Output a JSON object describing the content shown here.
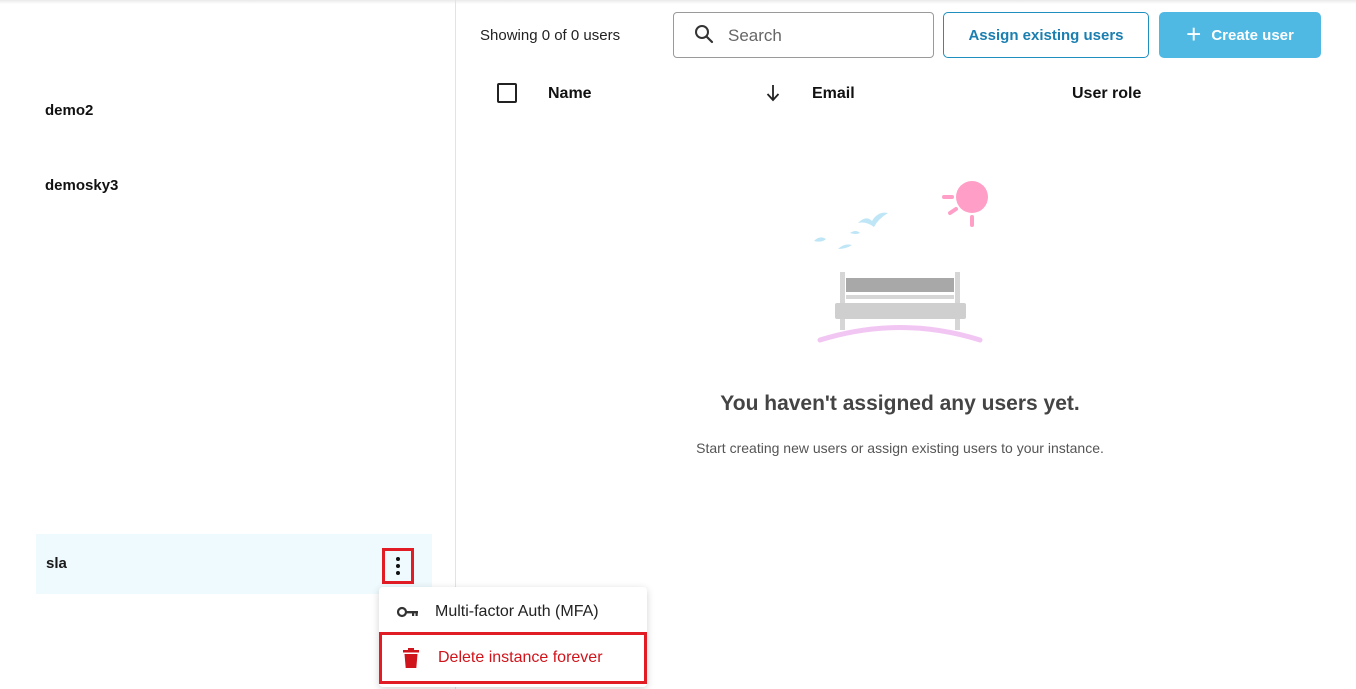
{
  "sidebar": {
    "instances": [
      "demo2",
      "demosky3"
    ],
    "selected_instance": "sla"
  },
  "context_menu": {
    "mfa_label": "Multi-factor Auth (MFA)",
    "delete_label": "Delete instance forever"
  },
  "users": {
    "showing": "Showing 0 of 0 users",
    "search_placeholder": "Search",
    "assign_button": "Assign existing users",
    "create_button": "Create user",
    "columns": {
      "name": "Name",
      "email": "Email",
      "role": "User role"
    },
    "empty_title": "You haven't assigned any users yet.",
    "empty_subtitle": "Start creating new users or assign existing users to your instance."
  },
  "colors": {
    "accent": "#4fb9e4",
    "danger": "#d0141b",
    "highlight_border": "#e21c24",
    "selected_row": "#eefafd"
  }
}
